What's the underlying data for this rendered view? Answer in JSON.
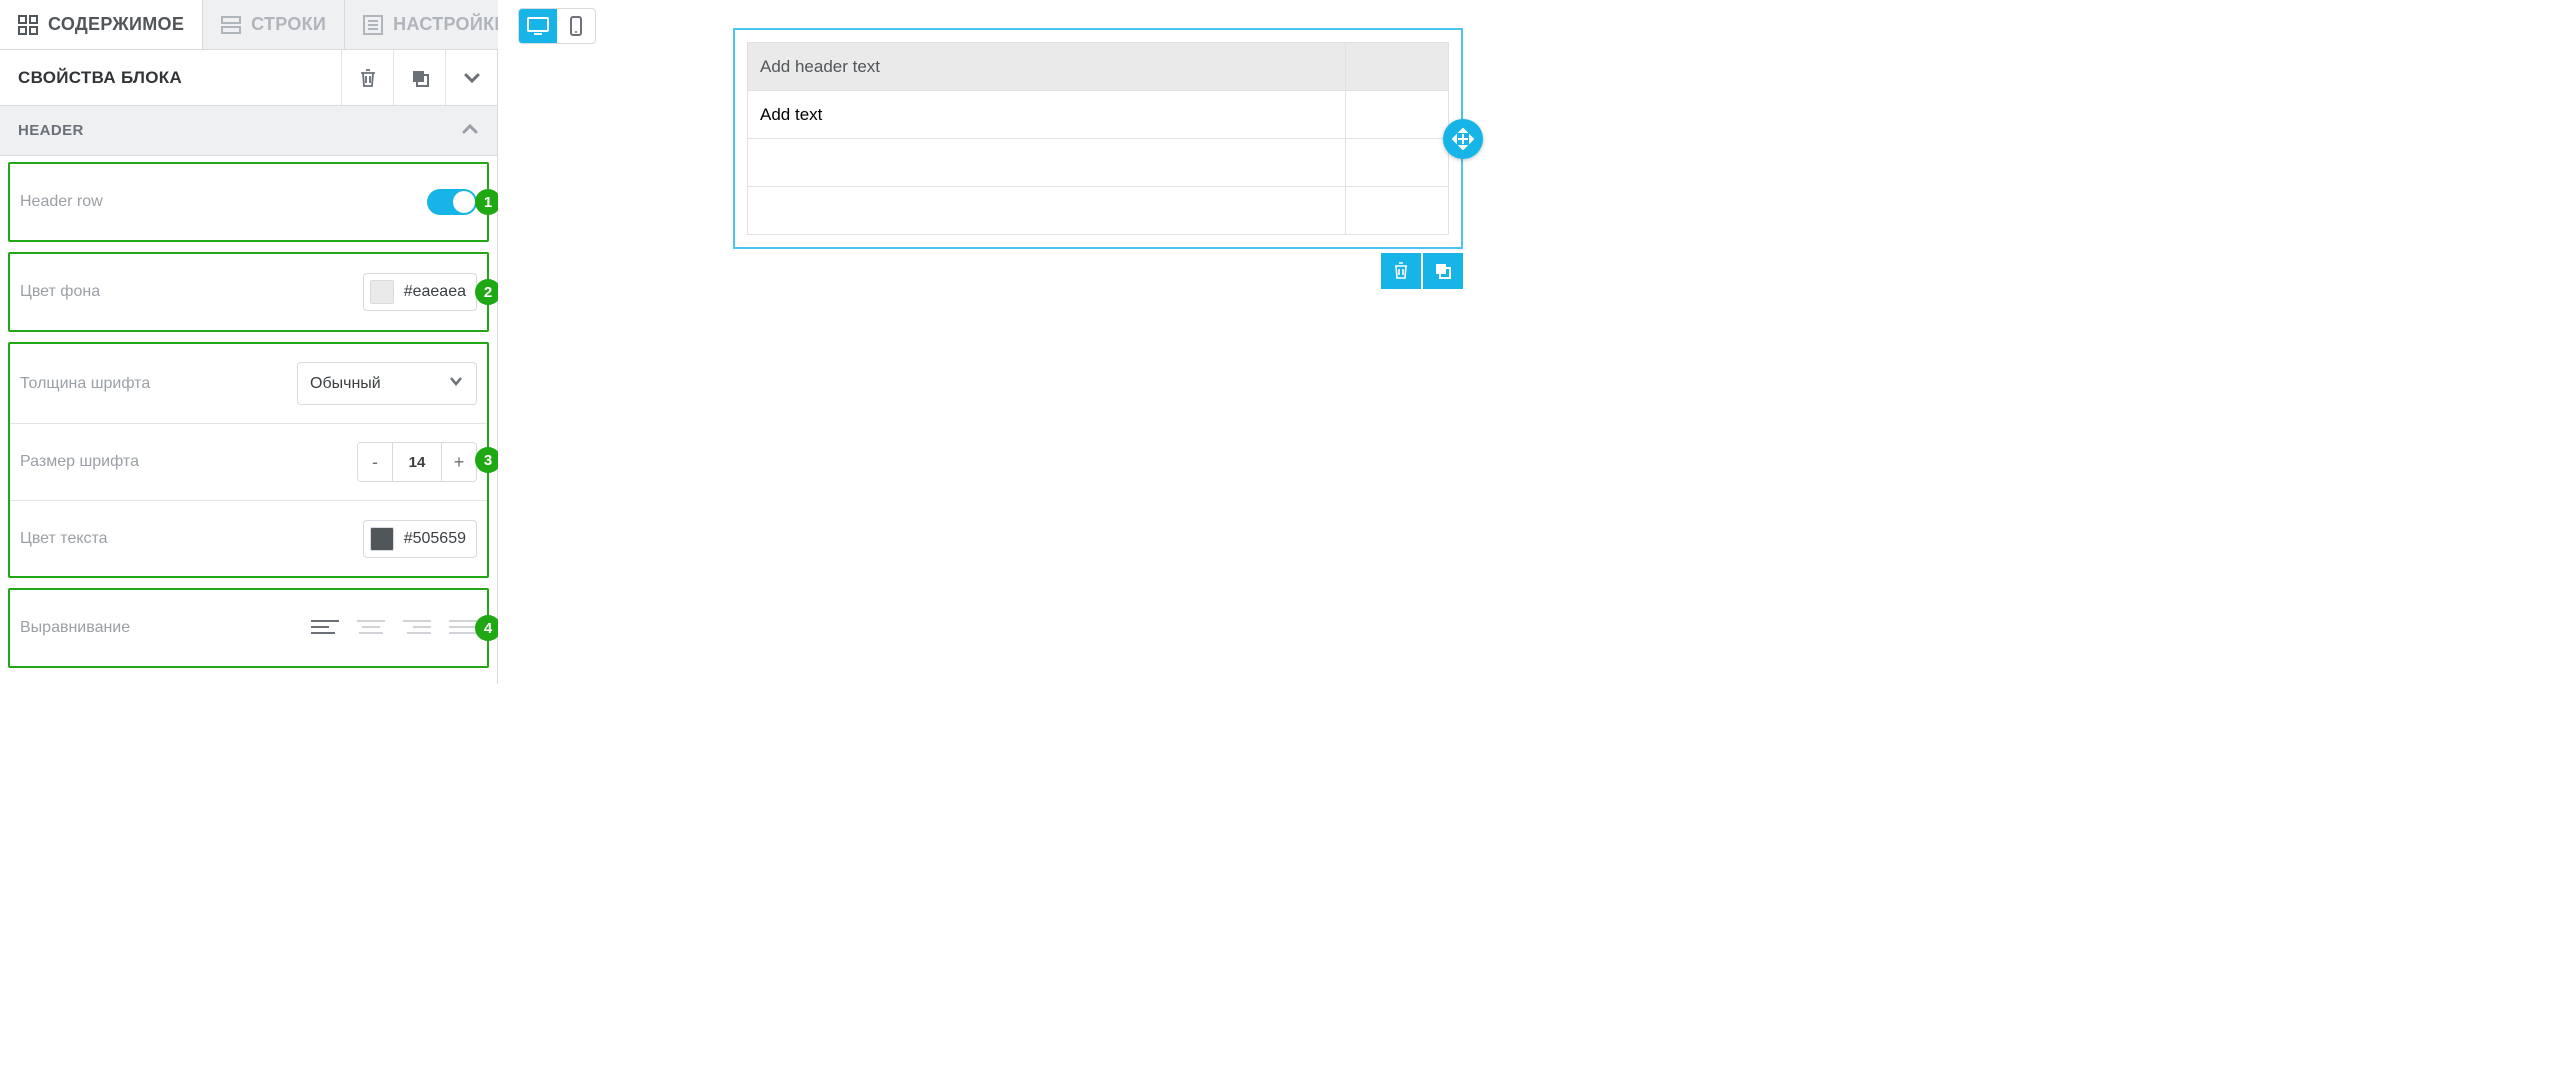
{
  "tabs": {
    "content": "СОДЕРЖИМОЕ",
    "rows": "СТРОКИ",
    "settings": "НАСТРОЙКИ"
  },
  "block": {
    "properties_title": "СВОЙСТВА БЛОКА"
  },
  "section": {
    "header": "HEADER"
  },
  "props": {
    "header_row_label": "Header row",
    "bg_label": "Цвет фона",
    "bg_value": "#eaeaea",
    "bg_swatch": "#eaeaea",
    "weight_label": "Толщина шрифта",
    "weight_value": "Обычный",
    "size_label": "Размер шрифта",
    "size_value": "14",
    "text_color_label": "Цвет текста",
    "text_color_value": "#505659",
    "text_color_swatch": "#505659",
    "align_label": "Выравнивание"
  },
  "badges": {
    "b1": "1",
    "b2": "2",
    "b3": "3",
    "b4": "4"
  },
  "canvas_table": {
    "header_placeholder": "Add header text",
    "cell_placeholder": "Add text"
  }
}
